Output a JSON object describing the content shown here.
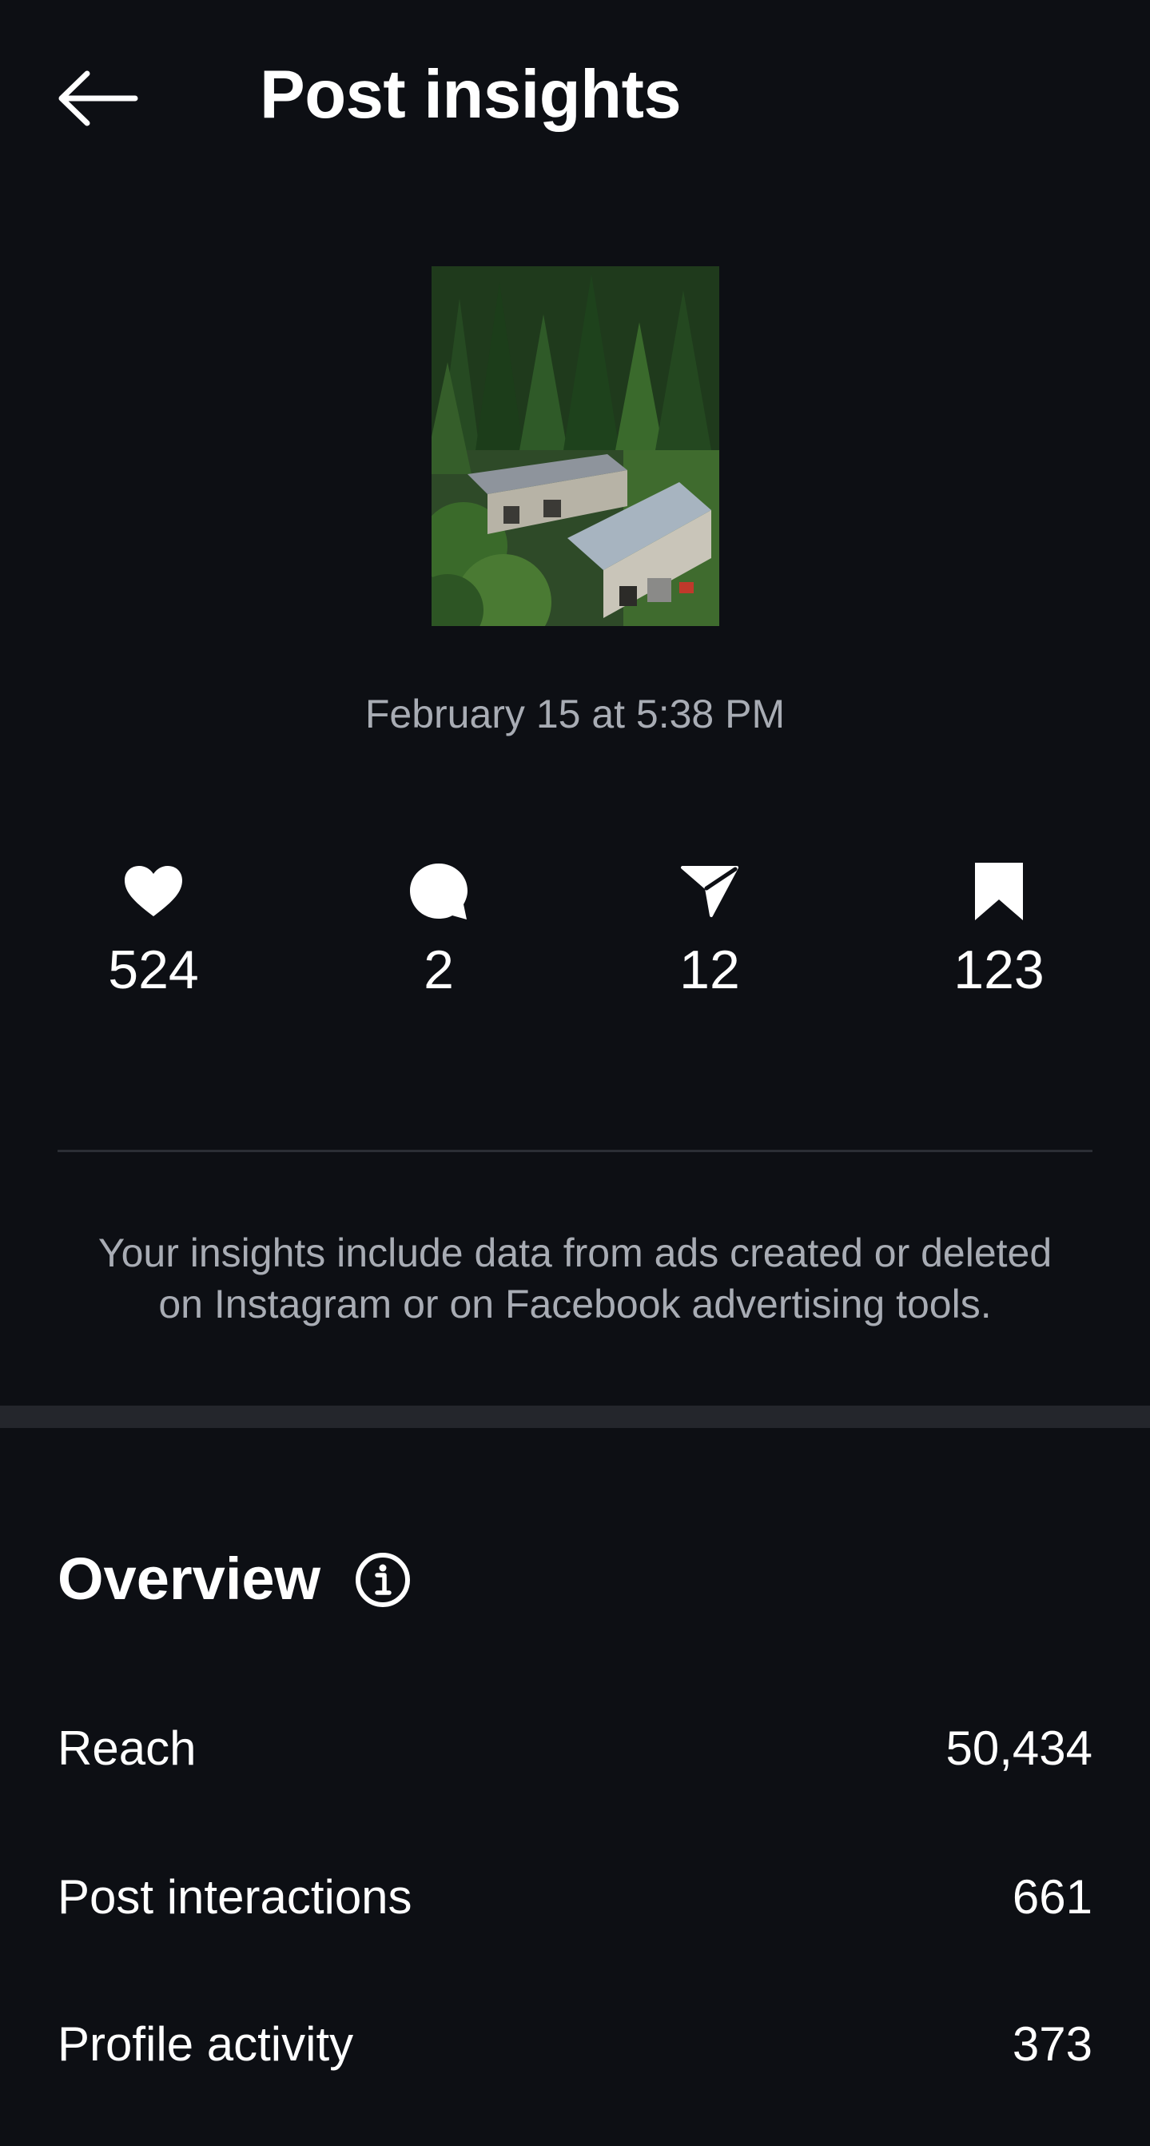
{
  "header": {
    "title": "Post insights",
    "back_icon": "arrow-left-icon"
  },
  "post": {
    "thumbnail_alt": "Aerial view of houses in a forest",
    "date": "February 15 at 5:38 PM"
  },
  "stats": [
    {
      "icon": "heart-icon",
      "value": "524"
    },
    {
      "icon": "comment-icon",
      "value": "2"
    },
    {
      "icon": "share-icon",
      "value": "12"
    },
    {
      "icon": "bookmark-icon",
      "value": "123"
    }
  ],
  "note": {
    "line1": "Your insights include data from ads created or deleted",
    "line2": "on Instagram or on Facebook advertising tools."
  },
  "overview": {
    "title": "Overview",
    "info_icon": "info-icon",
    "rows": [
      {
        "label": "Reach",
        "value": "50,434"
      },
      {
        "label": "Post interactions",
        "value": "661"
      },
      {
        "label": "Profile activity",
        "value": "373"
      }
    ]
  },
  "colors": {
    "background": "#0d0f14",
    "text": "#ffffff",
    "secondary_text": "#a8acb4",
    "divider": "#2b2e35",
    "band": "#24262c"
  }
}
